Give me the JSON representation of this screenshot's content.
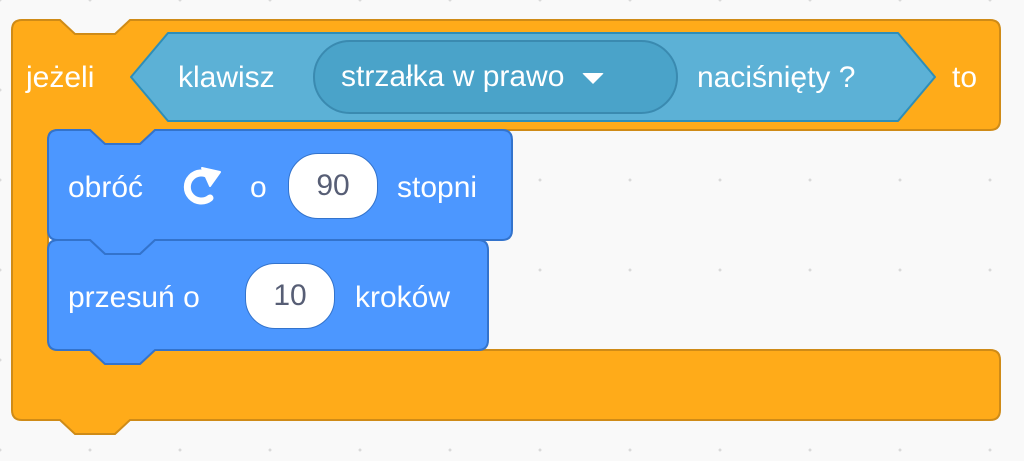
{
  "if_block": {
    "keyword_if": "jeżeli",
    "keyword_then": "to",
    "condition": {
      "label_key": "klawisz",
      "key_value": "strzałka w prawo",
      "label_pressed": "naciśnięty ?"
    }
  },
  "turn_block": {
    "label_turn": "obróć",
    "icon": "rotate-right-icon",
    "label_by": "o",
    "degrees": "90",
    "label_degrees": "stopni"
  },
  "move_block": {
    "label_move": "przesuń o",
    "steps": "10",
    "label_steps": "kroków"
  },
  "colors": {
    "control": "#ffab19",
    "sensing": "#5cb1d6",
    "motion": "#4c97ff"
  }
}
